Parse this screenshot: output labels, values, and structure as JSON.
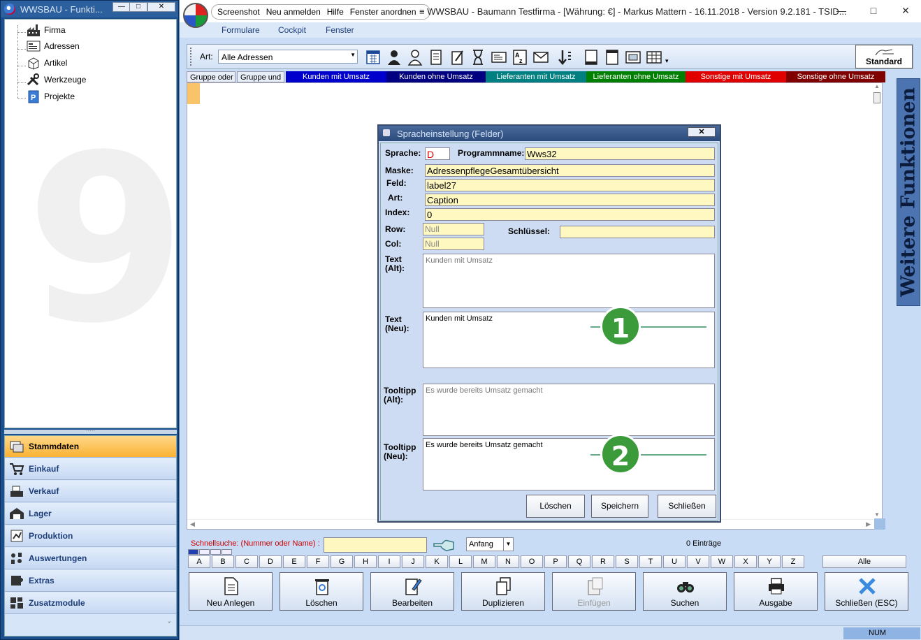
{
  "left_window": {
    "title": "WWSBAU - Funkti...",
    "controls": [
      "—",
      "□",
      "✕"
    ],
    "tree": [
      {
        "label": "Firma",
        "icon": "factory-icon"
      },
      {
        "label": "Adressen",
        "icon": "address-card-icon"
      },
      {
        "label": "Artikel",
        "icon": "box-icon"
      },
      {
        "label": "Werkzeuge",
        "icon": "tools-icon"
      },
      {
        "label": "Projekte",
        "icon": "project-icon"
      }
    ],
    "splitter": "·····",
    "nav": [
      {
        "label": "Stammdaten",
        "icon": "master-data-icon",
        "active": true
      },
      {
        "label": "Einkauf",
        "icon": "cart-icon"
      },
      {
        "label": "Verkauf",
        "icon": "cash-register-icon"
      },
      {
        "label": "Lager",
        "icon": "warehouse-icon"
      },
      {
        "label": "Produktion",
        "icon": "production-icon"
      },
      {
        "label": "Auswertungen",
        "icon": "reports-icon"
      },
      {
        "label": "Extras",
        "icon": "extras-icon"
      },
      {
        "label": "Zusatzmodule",
        "icon": "modules-icon"
      }
    ],
    "nav_more": "ˇ"
  },
  "main_window": {
    "menu_pill": [
      "Screenshot",
      "Neu anmelden",
      "Hilfe",
      "Fenster anordnen"
    ],
    "title": "≡ WWSBAU - Baumann Testfirma - [Währung: €] -   Markus Mattern - 16.11.2018 - Version 9.2.181 - TSID...",
    "title_controls": [
      "—",
      "□",
      "✕"
    ],
    "menubar": [
      "Formulare",
      "Cockpit",
      "Fenster"
    ],
    "toolbar": {
      "art_label": "Art:",
      "art_value": "Alle Adressen",
      "icons": [
        "calendar-icon",
        "person-icon",
        "person-outline-icon",
        "document-icon",
        "edit-doc-icon",
        "hourglass-icon",
        "card-icon",
        "az-sort-icon",
        "mail-icon",
        "sort-down-icon",
        "panel-icon",
        "window-icon",
        "screen-icon",
        "table-icon"
      ],
      "standard_label": "Standard"
    },
    "tabs": [
      {
        "label": "Gruppe oder",
        "bg": "#e8eef7",
        "fg": "#000000"
      },
      {
        "label": "Gruppe und",
        "bg": "#e8eef7",
        "fg": "#000000"
      },
      {
        "label": "Kunden mit Umsatz",
        "bg": "#0000cc",
        "fg": "#ffffff"
      },
      {
        "label": "Kunden ohne Umsatz",
        "bg": "#000080",
        "fg": "#ffffff"
      },
      {
        "label": "Lieferanten mit Umsatz",
        "bg": "#008080",
        "fg": "#ffffff"
      },
      {
        "label": "Lieferanten ohne Umsatz",
        "bg": "#008000",
        "fg": "#ffffff"
      },
      {
        "label": "Sonstige mit Umsatz",
        "bg": "#e00000",
        "fg": "#ffffff"
      },
      {
        "label": "Sonstige ohne Umsatz",
        "bg": "#800000",
        "fg": "#ffffff"
      }
    ],
    "side_tab": "Weitere Funktionen",
    "quicksearch": {
      "label": "Schnellsuche: (Nummer oder Name) :",
      "mode": "Anfang",
      "count": "0 Einträge"
    },
    "letters": [
      "A",
      "B",
      "C",
      "D",
      "E",
      "F",
      "G",
      "H",
      "I",
      "J",
      "K",
      "L",
      "M",
      "N",
      "O",
      "P",
      "Q",
      "R",
      "S",
      "T",
      "U",
      "V",
      "W",
      "X",
      "Y",
      "Z"
    ],
    "all_label": "Alle",
    "buttons": [
      {
        "label": "Neu Anlegen",
        "icon": "new-doc-icon"
      },
      {
        "label": "Löschen",
        "icon": "trash-icon"
      },
      {
        "label": "Bearbeiten",
        "icon": "edit-icon"
      },
      {
        "label": "Duplizieren",
        "icon": "duplicate-icon"
      },
      {
        "label": "Einfügen",
        "icon": "paste-icon",
        "disabled": true
      },
      {
        "label": "Suchen",
        "icon": "binoculars-icon"
      },
      {
        "label": "Ausgabe",
        "icon": "printer-icon"
      },
      {
        "label": "Schließen (ESC)",
        "icon": "close-x-icon"
      }
    ],
    "status": "NUM"
  },
  "dialog": {
    "title": "Spracheinstellung (Felder)",
    "close": "✕",
    "labels": {
      "sprache": "Sprache:",
      "programmname": "Programmname:",
      "maske": "Maske:",
      "feld": "Feld:",
      "art": "Art:",
      "index": "Index:",
      "row": "Row:",
      "col": "Col:",
      "schluessel": "Schlüssel:",
      "text_alt": "Text\n(Alt):",
      "text_neu": "Text\n(Neu):",
      "tooltip_alt": "Tooltipp\n(Alt):",
      "tooltip_neu": "Tooltipp\n(Neu):"
    },
    "values": {
      "sprache": "D",
      "programmname": "Wws32",
      "maske": "AdressenpflegeGesamtübersicht",
      "feld": "label27",
      "art": "Caption",
      "index": "0",
      "row": "Null",
      "col": "Null",
      "schluessel": "",
      "text_alt": "Kunden mit Umsatz",
      "text_neu": "Kunden mit Umsatz",
      "tooltip_alt": "Es wurde bereits Umsatz gemacht",
      "tooltip_neu": "Es wurde bereits Umsatz gemacht"
    },
    "buttons": [
      "Löschen",
      "Speichern",
      "Schließen"
    ],
    "badges": [
      "1",
      "2"
    ]
  }
}
